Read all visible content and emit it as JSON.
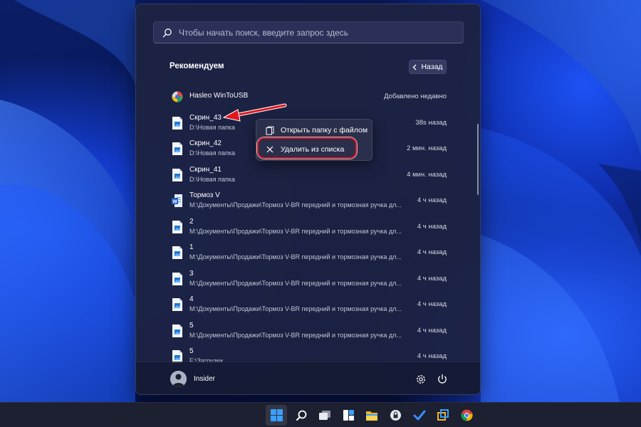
{
  "search": {
    "placeholder": "Чтобы начать поиск, введите запрос здесь"
  },
  "recommended": {
    "title": "Рекомендуем",
    "back_label": "Назад",
    "items": [
      {
        "name": "Hasleo WinToUSB",
        "path": "",
        "time": "Добавлено недавно",
        "icon": "app-icon"
      },
      {
        "name": "Скрин_43",
        "path": "D:\\Новая папка",
        "time": "38s назад",
        "icon": "image-file-icon"
      },
      {
        "name": "Скрин_42",
        "path": "D:\\Новая папка",
        "time": "2 мин. назад",
        "icon": "image-file-icon"
      },
      {
        "name": "Скрин_41",
        "path": "D:\\Новая папка",
        "time": "4 мин. назад",
        "icon": "image-file-icon"
      },
      {
        "name": "Тормоз V",
        "path": "M:\\Документы\\Продажи\\Тормоз V-BR передний и тормозная ручка дл...",
        "time": "4 ч назад",
        "icon": "word-file-icon"
      },
      {
        "name": "2",
        "path": "M:\\Документы\\Продажи\\Тормоз V-BR передний и тормозная ручка дл...",
        "time": "4 ч назад",
        "icon": "image-file-icon"
      },
      {
        "name": "1",
        "path": "M:\\Документы\\Продажи\\Тормоз V-BR передний и тормозная ручка дл...",
        "time": "4 ч назад",
        "icon": "image-file-icon"
      },
      {
        "name": "3",
        "path": "M:\\Документы\\Продажи\\Тормоз V-BR передний и тормозная ручка дл...",
        "time": "4 ч назад",
        "icon": "image-file-icon"
      },
      {
        "name": "4",
        "path": "M:\\Документы\\Продажи\\Тормоз V-BR передний и тормозная ручка дл...",
        "time": "4 ч назад",
        "icon": "image-file-icon"
      },
      {
        "name": "5",
        "path": "M:\\Документы\\Продажи\\Тормоз V-BR передний и тормозная ручка дл...",
        "time": "4 ч назад",
        "icon": "image-file-icon"
      },
      {
        "name": "5",
        "path": "F:\\Загрузки",
        "time": "4 ч назад",
        "icon": "image-file-icon"
      }
    ]
  },
  "context_menu": {
    "open_folder_label": "Открыть папку с файлом",
    "remove_label": "Удалить из списка"
  },
  "user": {
    "name": "Insider"
  },
  "taskbar": {
    "icons": [
      "start-icon",
      "search-icon",
      "task-view-icon",
      "widgets-icon",
      "file-explorer-icon",
      "lock-app-icon",
      "todo-icon",
      "network-app-icon",
      "chrome-icon"
    ]
  },
  "colors": {
    "accent": "#2a7fff",
    "highlight_red": "#e2161f",
    "menu_bg": "#1c2242"
  }
}
